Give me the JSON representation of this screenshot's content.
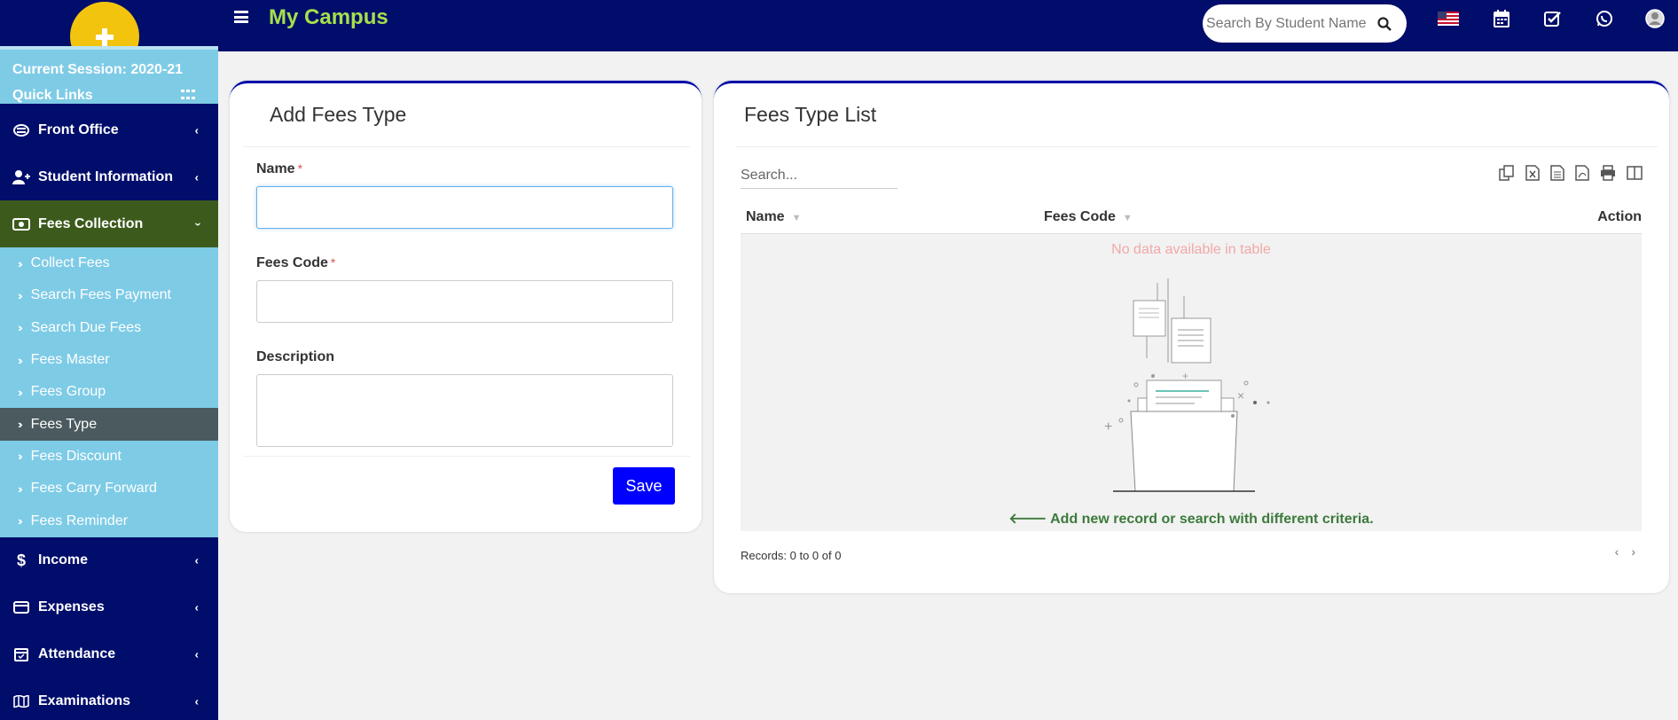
{
  "app": {
    "title": "My Campus"
  },
  "sidebar": {
    "session": "Current Session: 2020-21",
    "quick_links": "Quick Links",
    "items": [
      {
        "label": "Front Office"
      },
      {
        "label": "Student Information"
      },
      {
        "label": "Fees Collection"
      },
      {
        "label": "Income"
      },
      {
        "label": "Expenses"
      },
      {
        "label": "Attendance"
      },
      {
        "label": "Examinations"
      }
    ],
    "fees_sub": [
      "Collect Fees",
      "Search Fees Payment",
      "Search Due Fees",
      "Fees Master",
      "Fees Group",
      "Fees Type",
      "Fees Discount",
      "Fees Carry Forward",
      "Fees Reminder"
    ]
  },
  "topbar": {
    "search_placeholder": "Search By Student Name"
  },
  "form": {
    "title": "Add Fees Type",
    "name_label": "Name",
    "code_label": "Fees Code",
    "desc_label": "Description",
    "required_mark": "*",
    "name_value": "",
    "code_value": "",
    "save_label": "Save"
  },
  "list": {
    "title": "Fees Type List",
    "search_placeholder": "Search...",
    "columns": [
      "Name",
      "Fees Code",
      "Action"
    ],
    "no_data": "No data available in table",
    "add_hint": "Add new record or search with different criteria.",
    "records": "Records: 0 to 0 of 0"
  },
  "colors": {
    "brand": "#000d6b",
    "accent": "#a6e04a",
    "sidebar_sub": "#7ecbe6",
    "active": "#3c5a1c"
  }
}
